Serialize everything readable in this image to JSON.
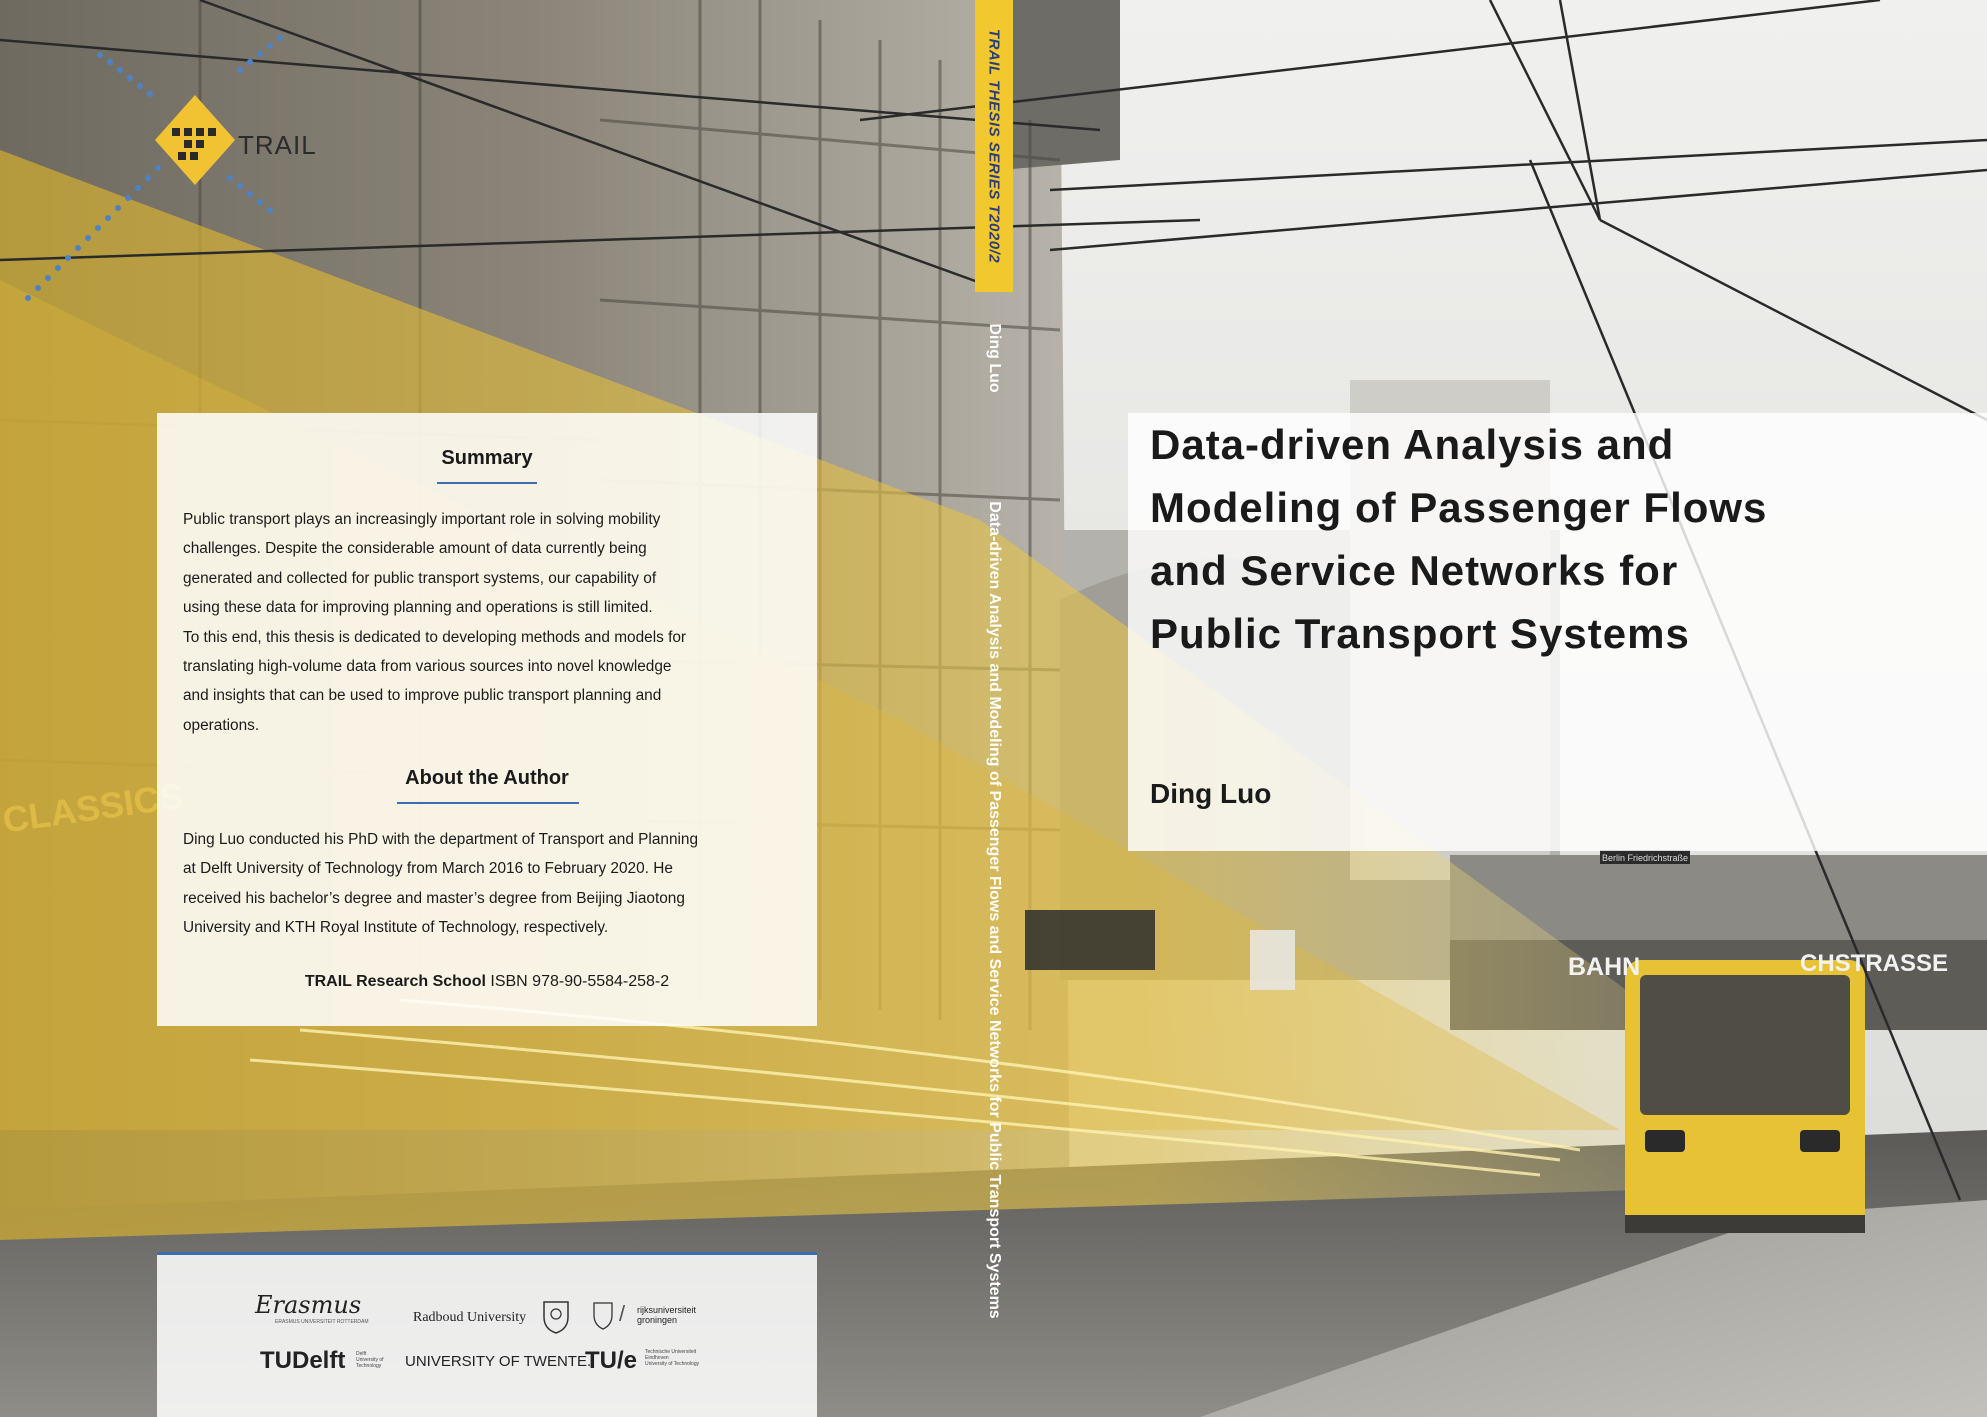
{
  "cover": {
    "publisher_logo_text": "TRAIL",
    "spine": {
      "series": "TRAIL THESIS SERIES T2020/2",
      "author": "Ding Luo",
      "title": "Data-driven Analysis and Modeling of Passenger Flows and Service Networks for Public Transport Systems"
    },
    "back": {
      "summary_heading": "Summary",
      "summary_lines": [
        "Public transport plays an increasingly important role in solving mobility",
        "challenges. Despite the considerable amount of data currently being",
        "generated and collected for public transport systems, our capability of",
        "using these data for improving planning and operations is still limited.",
        "To this end, this thesis is dedicated to developing methods and models for",
        "translating high-volume data from various sources into novel knowledge",
        "and insights that can be used to improve public transport planning and",
        "operations."
      ],
      "author_heading": "About the Author",
      "author_lines": [
        "Ding Luo conducted his PhD with the department of Transport and Planning",
        "at Delft University of Technology from March 2016 to February 2020. He",
        "received his bachelor’s degree and master’s degree from Beijing Jiaotong",
        "University and KTH Royal Institute of Technology, respectively."
      ],
      "school": "TRAIL Research School",
      "isbn": "ISBN 978-90-5584-258-2"
    },
    "logos": {
      "erasmus": "Erasmus",
      "erasmus_sub": "ERASMUS UNIVERSITEIT ROTTERDAM",
      "radboud": "Radboud University",
      "groningen_1": "rijksuniversiteit",
      "groningen_2": "groningen",
      "tudelft": "TUDelft",
      "tudelft_sub_1": "Delft",
      "tudelft_sub_2": "University of",
      "tudelft_sub_3": "Technology",
      "twente": "UNIVERSITY OF TWENTE.",
      "tue": "TU/e",
      "tue_sub_1": "Technische Universiteit",
      "tue_sub_2": "Eindhoven",
      "tue_sub_3": "University of Technology"
    },
    "front": {
      "title_lines": [
        "Data-driven Analysis and",
        "Modeling of Passenger Flows",
        "and Service Networks for",
        "Public Transport Systems"
      ],
      "author": "Ding Luo"
    },
    "photo_signs": {
      "bahn": "BAHN",
      "strasse": "CHSTRASSE",
      "classics": "CLASSICS",
      "station": "Berlin Friedrichstraße"
    }
  }
}
